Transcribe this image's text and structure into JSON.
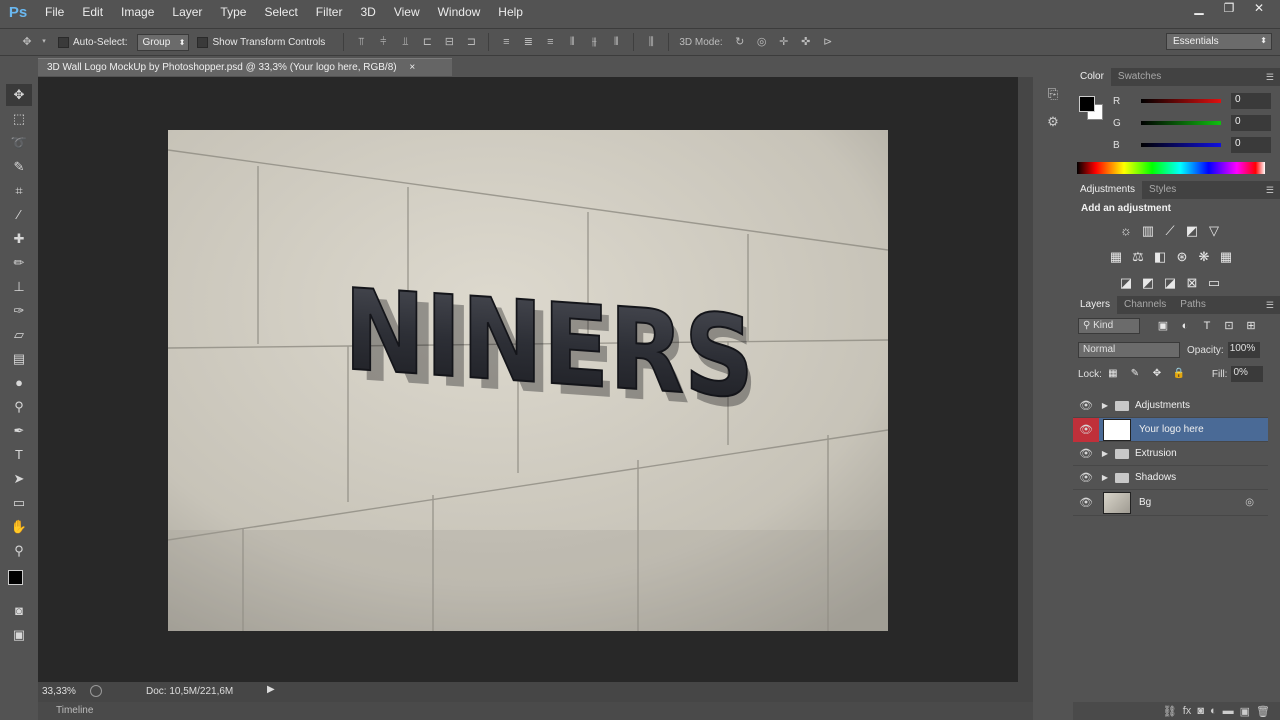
{
  "app": {
    "logo": "Ps"
  },
  "menu": [
    "File",
    "Edit",
    "Image",
    "Layer",
    "Type",
    "Select",
    "Filter",
    "3D",
    "View",
    "Window",
    "Help"
  ],
  "window_controls": [
    "▁",
    "❐",
    "✕"
  ],
  "options": {
    "move_icon": "move-tool-icon",
    "auto_select_label": "Auto-Select:",
    "auto_select_value": "Group",
    "transform_label": "Show Transform Controls",
    "mode_label": "3D Mode:",
    "workspace": "Essentials"
  },
  "document": {
    "tab_title": "3D Wall Logo MockUp by Photoshopper.psd @ 33,3% (Your logo here, RGB/8)",
    "close": "×",
    "logo_text": "NINERS"
  },
  "status": {
    "zoom": "33,33%",
    "doc": "Doc: 10,5M/221,6M"
  },
  "timeline": "Timeline",
  "color_panel": {
    "tabs": [
      "Color",
      "Swatches"
    ],
    "channels": [
      {
        "name": "R",
        "value": "0",
        "color": "#e01010"
      },
      {
        "name": "G",
        "value": "0",
        "color": "#10c010"
      },
      {
        "name": "B",
        "value": "0",
        "color": "#1010e0"
      }
    ]
  },
  "adjustments_panel": {
    "tabs": [
      "Adjustments",
      "Styles"
    ],
    "heading": "Add an adjustment"
  },
  "layers_panel": {
    "tabs": [
      "Layers",
      "Channels",
      "Paths"
    ],
    "kind": "Kind",
    "blend_mode": "Normal",
    "opacity_label": "Opacity:",
    "opacity": "100%",
    "lock_label": "Lock:",
    "fill_label": "Fill:",
    "fill": "0%",
    "layers": [
      {
        "name": "Adjustments",
        "type": "group",
        "selected": false
      },
      {
        "name": "Your logo here",
        "type": "smart",
        "selected": true
      },
      {
        "name": "Extrusion",
        "type": "group",
        "selected": false
      },
      {
        "name": "Shadows",
        "type": "group",
        "selected": false
      },
      {
        "name": "Bg",
        "type": "smart",
        "selected": false
      }
    ]
  },
  "colors": {
    "accent": "#4a6a96",
    "eye_selected": "#c0303a"
  }
}
